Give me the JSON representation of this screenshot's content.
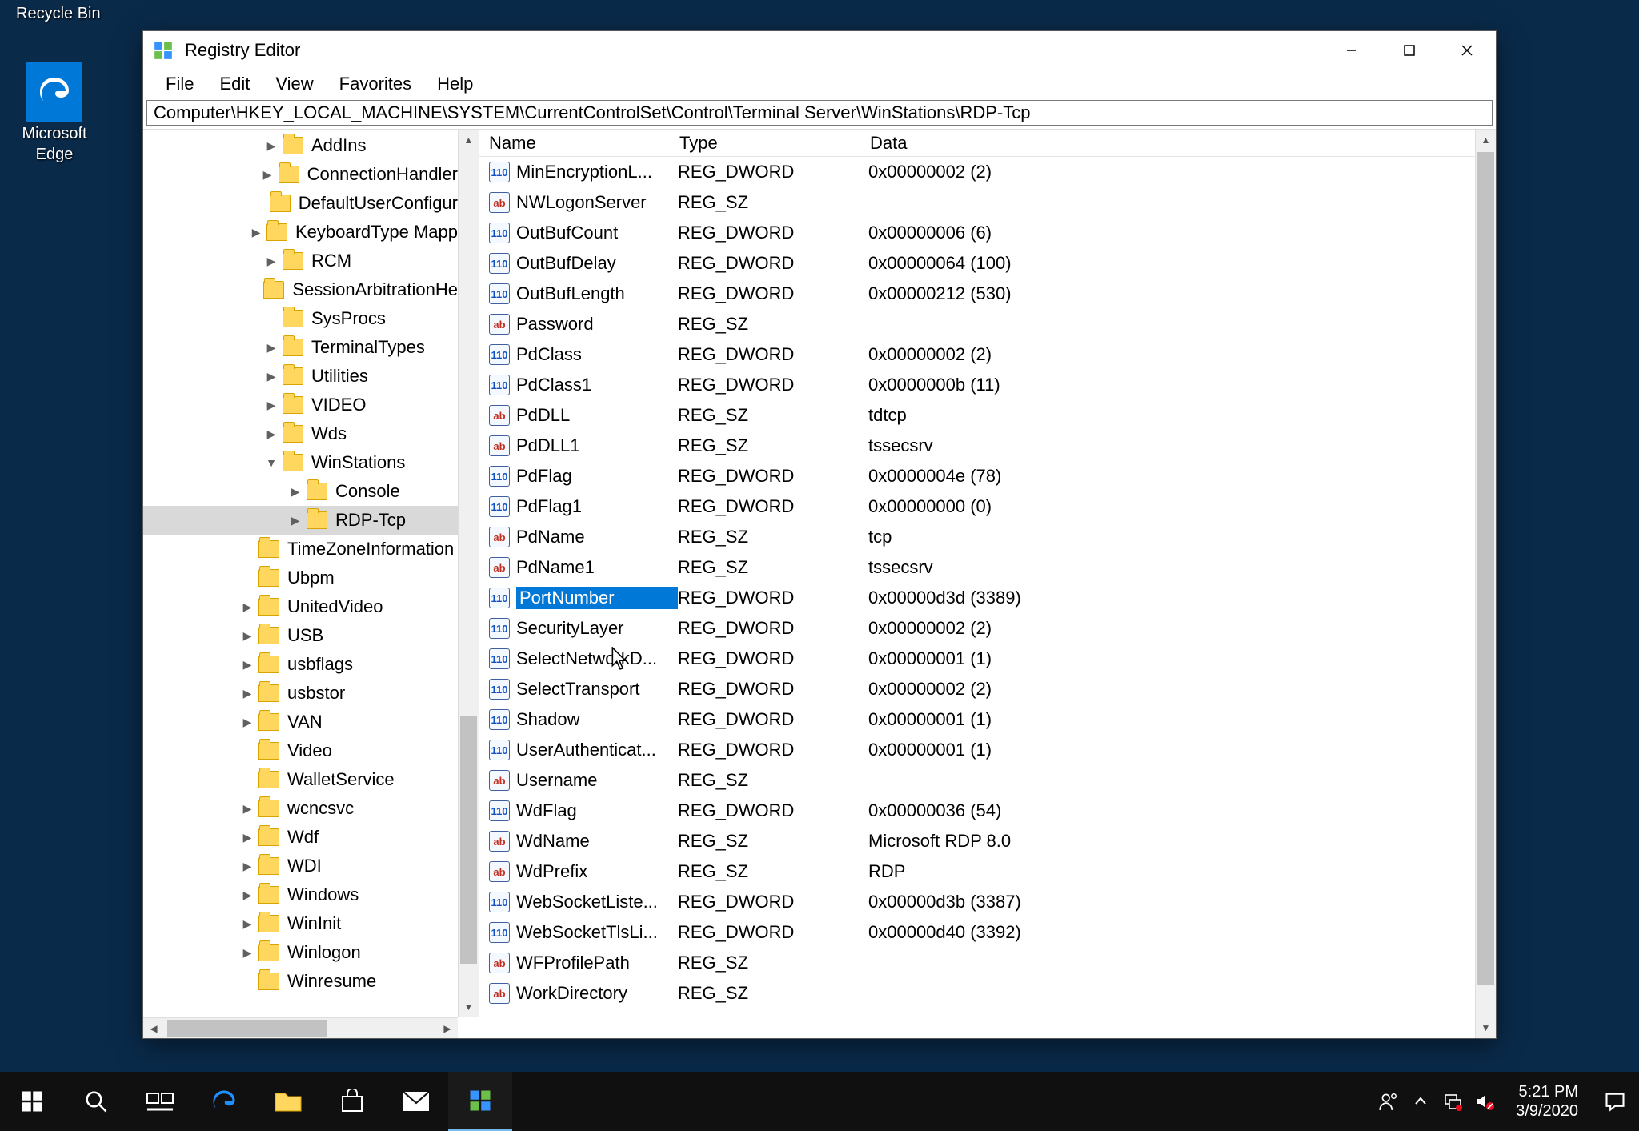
{
  "desktop": {
    "recycle_label": "Recycle Bin",
    "edge_label": "Microsoft\nEdge"
  },
  "window": {
    "title": "Registry Editor",
    "menu": [
      "File",
      "Edit",
      "View",
      "Favorites",
      "Help"
    ],
    "address": "Computer\\HKEY_LOCAL_MACHINE\\SYSTEM\\CurrentControlSet\\Control\\Terminal Server\\WinStations\\RDP-Tcp"
  },
  "tree": [
    {
      "depth": 3,
      "exp": ">",
      "label": "AddIns"
    },
    {
      "depth": 3,
      "exp": ">",
      "label": "ConnectionHandler"
    },
    {
      "depth": 3,
      "exp": "",
      "label": "DefaultUserConfigur"
    },
    {
      "depth": 3,
      "exp": ">",
      "label": "KeyboardType Mapp"
    },
    {
      "depth": 3,
      "exp": ">",
      "label": "RCM"
    },
    {
      "depth": 3,
      "exp": "",
      "label": "SessionArbitrationHe"
    },
    {
      "depth": 3,
      "exp": "",
      "label": "SysProcs"
    },
    {
      "depth": 3,
      "exp": ">",
      "label": "TerminalTypes"
    },
    {
      "depth": 3,
      "exp": ">",
      "label": "Utilities"
    },
    {
      "depth": 3,
      "exp": ">",
      "label": "VIDEO"
    },
    {
      "depth": 3,
      "exp": ">",
      "label": "Wds"
    },
    {
      "depth": 3,
      "exp": "v",
      "label": "WinStations"
    },
    {
      "depth": 4,
      "exp": ">",
      "label": "Console"
    },
    {
      "depth": 4,
      "exp": ">",
      "label": "RDP-Tcp",
      "selected": true
    },
    {
      "depth": 2,
      "exp": "",
      "label": "TimeZoneInformation"
    },
    {
      "depth": 2,
      "exp": "",
      "label": "Ubpm"
    },
    {
      "depth": 2,
      "exp": ">",
      "label": "UnitedVideo"
    },
    {
      "depth": 2,
      "exp": ">",
      "label": "USB"
    },
    {
      "depth": 2,
      "exp": ">",
      "label": "usbflags"
    },
    {
      "depth": 2,
      "exp": ">",
      "label": "usbstor"
    },
    {
      "depth": 2,
      "exp": ">",
      "label": "VAN"
    },
    {
      "depth": 2,
      "exp": "",
      "label": "Video"
    },
    {
      "depth": 2,
      "exp": "",
      "label": "WalletService"
    },
    {
      "depth": 2,
      "exp": ">",
      "label": "wcncsvc"
    },
    {
      "depth": 2,
      "exp": ">",
      "label": "Wdf"
    },
    {
      "depth": 2,
      "exp": ">",
      "label": "WDI"
    },
    {
      "depth": 2,
      "exp": ">",
      "label": "Windows"
    },
    {
      "depth": 2,
      "exp": ">",
      "label": "WinInit"
    },
    {
      "depth": 2,
      "exp": ">",
      "label": "Winlogon"
    },
    {
      "depth": 2,
      "exp": "",
      "label": "Winresume"
    }
  ],
  "columns": {
    "name": "Name",
    "type": "Type",
    "data": "Data"
  },
  "values": [
    {
      "icon": "dword",
      "name": "MinEncryptionL...",
      "type": "REG_DWORD",
      "data": "0x00000002 (2)"
    },
    {
      "icon": "sz",
      "name": "NWLogonServer",
      "type": "REG_SZ",
      "data": ""
    },
    {
      "icon": "dword",
      "name": "OutBufCount",
      "type": "REG_DWORD",
      "data": "0x00000006 (6)"
    },
    {
      "icon": "dword",
      "name": "OutBufDelay",
      "type": "REG_DWORD",
      "data": "0x00000064 (100)"
    },
    {
      "icon": "dword",
      "name": "OutBufLength",
      "type": "REG_DWORD",
      "data": "0x00000212 (530)"
    },
    {
      "icon": "sz",
      "name": "Password",
      "type": "REG_SZ",
      "data": ""
    },
    {
      "icon": "dword",
      "name": "PdClass",
      "type": "REG_DWORD",
      "data": "0x00000002 (2)"
    },
    {
      "icon": "dword",
      "name": "PdClass1",
      "type": "REG_DWORD",
      "data": "0x0000000b (11)"
    },
    {
      "icon": "sz",
      "name": "PdDLL",
      "type": "REG_SZ",
      "data": "tdtcp"
    },
    {
      "icon": "sz",
      "name": "PdDLL1",
      "type": "REG_SZ",
      "data": "tssecsrv"
    },
    {
      "icon": "dword",
      "name": "PdFlag",
      "type": "REG_DWORD",
      "data": "0x0000004e (78)"
    },
    {
      "icon": "dword",
      "name": "PdFlag1",
      "type": "REG_DWORD",
      "data": "0x00000000 (0)"
    },
    {
      "icon": "sz",
      "name": "PdName",
      "type": "REG_SZ",
      "data": "tcp"
    },
    {
      "icon": "sz",
      "name": "PdName1",
      "type": "REG_SZ",
      "data": "tssecsrv"
    },
    {
      "icon": "dword",
      "name": "PortNumber",
      "type": "REG_DWORD",
      "data": "0x00000d3d (3389)",
      "selected": true
    },
    {
      "icon": "dword",
      "name": "SecurityLayer",
      "type": "REG_DWORD",
      "data": "0x00000002 (2)"
    },
    {
      "icon": "dword",
      "name": "SelectNetworkD...",
      "type": "REG_DWORD",
      "data": "0x00000001 (1)"
    },
    {
      "icon": "dword",
      "name": "SelectTransport",
      "type": "REG_DWORD",
      "data": "0x00000002 (2)"
    },
    {
      "icon": "dword",
      "name": "Shadow",
      "type": "REG_DWORD",
      "data": "0x00000001 (1)"
    },
    {
      "icon": "dword",
      "name": "UserAuthenticat...",
      "type": "REG_DWORD",
      "data": "0x00000001 (1)"
    },
    {
      "icon": "sz",
      "name": "Username",
      "type": "REG_SZ",
      "data": ""
    },
    {
      "icon": "dword",
      "name": "WdFlag",
      "type": "REG_DWORD",
      "data": "0x00000036 (54)"
    },
    {
      "icon": "sz",
      "name": "WdName",
      "type": "REG_SZ",
      "data": "Microsoft RDP 8.0"
    },
    {
      "icon": "sz",
      "name": "WdPrefix",
      "type": "REG_SZ",
      "data": "RDP"
    },
    {
      "icon": "dword",
      "name": "WebSocketListe...",
      "type": "REG_DWORD",
      "data": "0x00000d3b (3387)"
    },
    {
      "icon": "dword",
      "name": "WebSocketTlsLi...",
      "type": "REG_DWORD",
      "data": "0x00000d40 (3392)"
    },
    {
      "icon": "sz",
      "name": "WFProfilePath",
      "type": "REG_SZ",
      "data": ""
    },
    {
      "icon": "sz",
      "name": "WorkDirectory",
      "type": "REG_SZ",
      "data": ""
    }
  ],
  "taskbar": {
    "time": "5:21 PM",
    "date": "3/9/2020"
  }
}
